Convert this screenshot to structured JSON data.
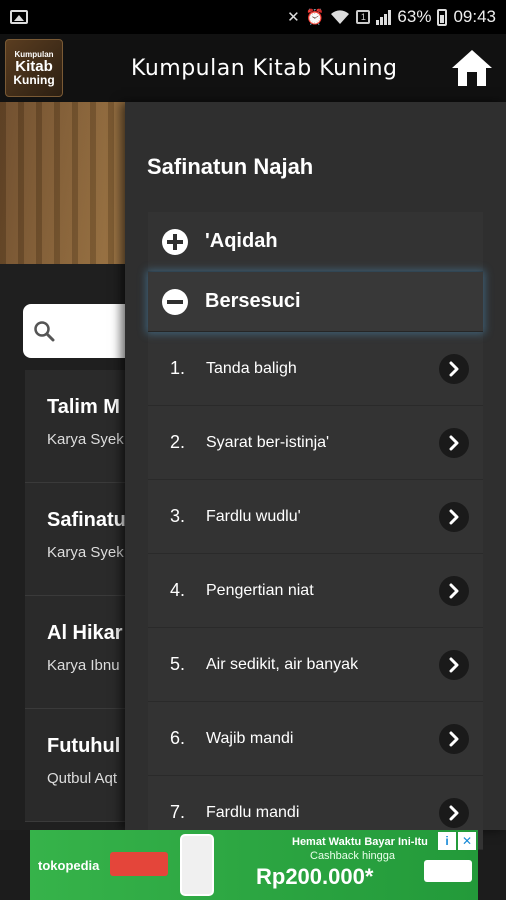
{
  "status_bar": {
    "battery": "63%",
    "time": "09:43",
    "icons": [
      "image-icon",
      "mute-icon",
      "alarm-icon",
      "wifi-icon",
      "sim-icon",
      "signal-icon",
      "battery-icon"
    ]
  },
  "app_bar": {
    "logo_line1": "Kumpulan",
    "logo_line2": "Kitab",
    "logo_line3": "Kuning",
    "title": "Kumpulan Kitab Kuning",
    "home_icon": "home-icon"
  },
  "background_list": {
    "search_placeholder": "",
    "items": [
      {
        "title": "Talim M",
        "subtitle": "Karya Syek"
      },
      {
        "title": "Safinatu",
        "subtitle": "Karya Syek"
      },
      {
        "title": "Al Hikar",
        "subtitle": "Karya Ibnu"
      },
      {
        "title": "Futuhul",
        "subtitle": "Qutbul Aqt"
      }
    ]
  },
  "drawer": {
    "title": "Safinatun Najah",
    "sections": [
      {
        "label": "'Aqidah",
        "expanded": false
      },
      {
        "label": "Bersesuci",
        "expanded": true
      }
    ],
    "items": [
      {
        "num": "1.",
        "label": "Tanda baligh"
      },
      {
        "num": "2.",
        "label": "Syarat ber-istinja'"
      },
      {
        "num": "3.",
        "label": "Fardlu wudlu'"
      },
      {
        "num": "4.",
        "label": "Pengertian niat"
      },
      {
        "num": "5.",
        "label": "Air sedikit, air banyak"
      },
      {
        "num": "6.",
        "label": "Wajib mandi"
      },
      {
        "num": "7.",
        "label": "Fardlu mandi"
      }
    ]
  },
  "ad": {
    "brand": "tokopedia",
    "line1": "Hemat Waktu Bayar Ini-Itu",
    "line2": "Cashback hingga",
    "line3": "Rp200.000*"
  },
  "colors": {
    "background": "#1c1c1c",
    "drawer": "#2f2f2f",
    "ad_green": "#36b34a",
    "active_glow": "#5096c8"
  }
}
